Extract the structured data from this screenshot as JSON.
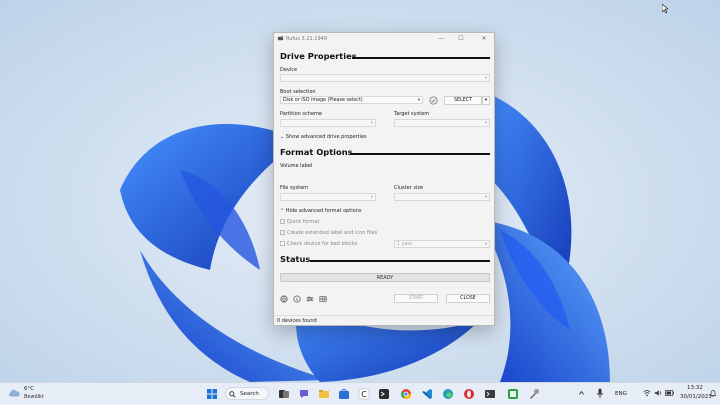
{
  "window": {
    "title": "Rufus 3.21.1949",
    "controls": {
      "minimize": "—",
      "maximize": "☐",
      "close": "✕"
    }
  },
  "drive_properties": {
    "heading": "Drive Properties",
    "device_label": "Device",
    "device_value": "",
    "boot_selection_label": "Boot selection",
    "boot_selection_value": "Disk or ISO image (Please select)",
    "select_button": "SELECT",
    "partition_scheme_label": "Partition scheme",
    "target_system_label": "Target system",
    "advanced_toggle": "Show advanced drive properties"
  },
  "format_options": {
    "heading": "Format Options",
    "volume_label_label": "Volume label",
    "file_system_label": "File system",
    "cluster_size_label": "Cluster size",
    "advanced_toggle": "Hide advanced format options",
    "quick_format": "Quick format",
    "extended_label": "Create extended label and icon files",
    "bad_blocks": "Check device for bad blocks",
    "passes_value": "1 pass"
  },
  "status": {
    "heading": "Status",
    "progress_text": "READY",
    "start_button": "START",
    "close_button": "CLOSE",
    "footer": "0 devices found"
  },
  "taskbar": {
    "weather_temp": "6°C",
    "weather_desc": "Bewölkt",
    "search_label": "Search",
    "language": "ENG",
    "time": "13:32",
    "date": "30/01/2023",
    "icons": [
      "start-icon",
      "search-icon",
      "taskview-icon",
      "chat-icon",
      "explorer-icon",
      "store-icon",
      "app-c-icon",
      "app-dark-icon",
      "chrome-icon",
      "vscode-icon",
      "edge-icon",
      "opera-icon",
      "terminal-icon",
      "app-green-icon",
      "tool-icon"
    ]
  },
  "colors": {
    "accent": "#0067c0",
    "bloom": "#1f5fe0"
  }
}
